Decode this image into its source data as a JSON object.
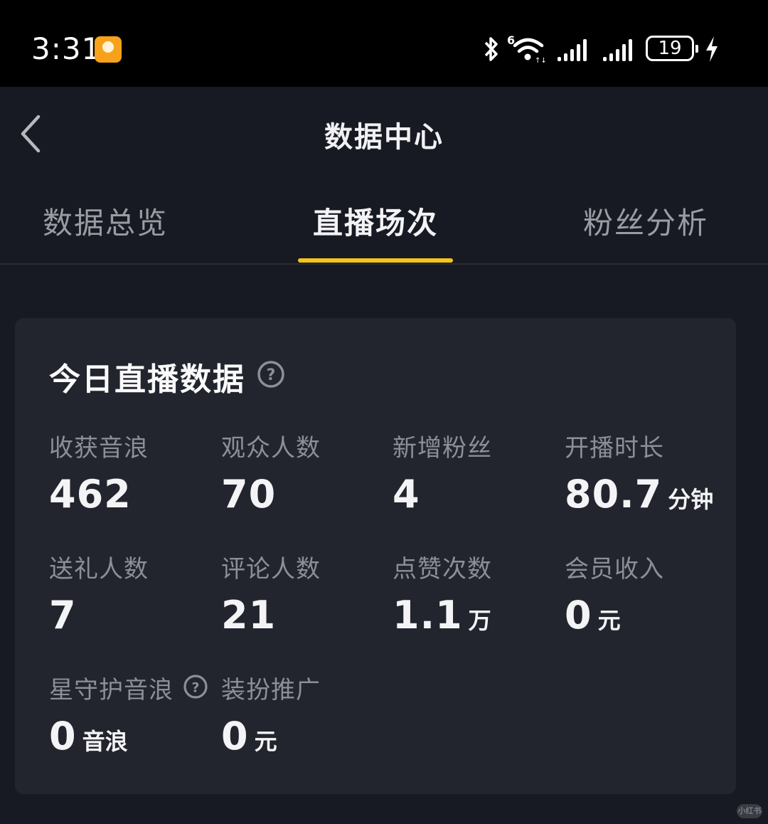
{
  "status_bar": {
    "time": "3:31",
    "app_badge_icon": "orange-app-icon",
    "icons": [
      "bluetooth-icon",
      "wifi-6-icon",
      "signal-icon",
      "signal-icon"
    ],
    "wifi_label": "6",
    "battery_level": "19",
    "charging_icon": "lightning-icon"
  },
  "header": {
    "back_icon": "chevron-left-icon",
    "title": "数据中心"
  },
  "tabs": [
    {
      "label": "数据总览",
      "active": false
    },
    {
      "label": "直播场次",
      "active": true
    },
    {
      "label": "粉丝分析",
      "active": false
    }
  ],
  "colors": {
    "accent": "#f5c41a",
    "background": "#171a22",
    "card": "#22252e"
  },
  "card": {
    "title": "今日直播数据",
    "title_help_icon": "question-circle-icon",
    "metrics": [
      {
        "label": "收获音浪",
        "value": "462",
        "unit": ""
      },
      {
        "label": "观众人数",
        "value": "70",
        "unit": ""
      },
      {
        "label": "新增粉丝",
        "value": "4",
        "unit": ""
      },
      {
        "label": "开播时长",
        "value": "80.7",
        "unit": "分钟"
      },
      {
        "label": "送礼人数",
        "value": "7",
        "unit": ""
      },
      {
        "label": "评论人数",
        "value": "21",
        "unit": ""
      },
      {
        "label": "点赞次数",
        "value": "1.1",
        "unit": "万"
      },
      {
        "label": "会员收入",
        "value": "0",
        "unit": "元"
      },
      {
        "label": "星守护音浪",
        "value": "0",
        "unit": "音浪",
        "help_icon": "question-circle-icon"
      },
      {
        "label": "装扮推广",
        "value": "0",
        "unit": "元"
      }
    ]
  },
  "watermark": "小红书"
}
